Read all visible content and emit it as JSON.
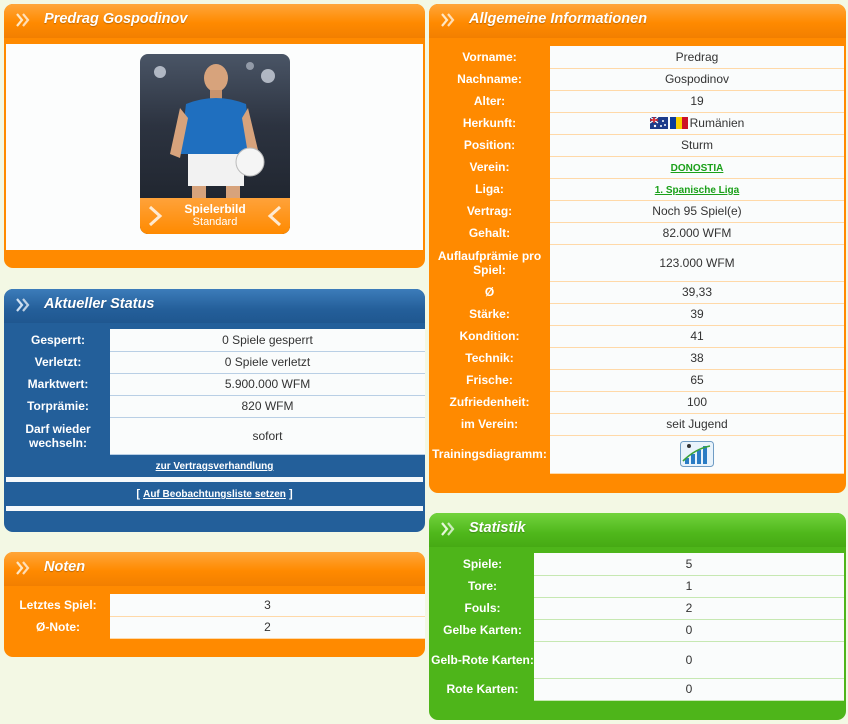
{
  "player_panel": {
    "title": "Predrag Gospodinov",
    "image_label_line1": "Spielerbild",
    "image_label_line2": "Standard"
  },
  "status": {
    "title": "Aktueller Status",
    "rows": [
      {
        "label": "Gesperrt:",
        "value": "0 Spiele gesperrt"
      },
      {
        "label": "Verletzt:",
        "value": "0 Spiele verletzt"
      },
      {
        "label": "Marktwert:",
        "value": "5.900.000 WFM"
      },
      {
        "label": "Torprämie:",
        "value": "820 WFM"
      },
      {
        "label": "Darf wieder wechseln:",
        "value": "sofort"
      }
    ],
    "contract_link": "zur Vertragsverhandlung",
    "watchlist_prefix": "[",
    "watchlist_link": "Auf Beobachtungsliste setzen",
    "watchlist_suffix": "]"
  },
  "noten": {
    "title": "Noten",
    "rows": [
      {
        "label": "Letztes Spiel:",
        "value": "3"
      },
      {
        "label": "Ø-Note:",
        "value": "2"
      }
    ]
  },
  "info": {
    "title": "Allgemeine Informationen",
    "rows": [
      {
        "label": "Vorname:",
        "value": "Predrag"
      },
      {
        "label": "Nachname:",
        "value": "Gospodinov"
      },
      {
        "label": "Alter:",
        "value": "19"
      },
      {
        "label": "Herkunft:",
        "value": "Rumänien"
      },
      {
        "label": "Position:",
        "value": "Sturm"
      },
      {
        "label": "Verein:",
        "value": "DONOSTIA"
      },
      {
        "label": "Liga:",
        "value": "1. Spanische Liga"
      },
      {
        "label": "Vertrag:",
        "value": "Noch 95 Spiel(e)"
      },
      {
        "label": "Gehalt:",
        "value": "82.000 WFM"
      },
      {
        "label": "Auflaufprämie pro Spiel:",
        "value": "123.000 WFM"
      },
      {
        "label": "Ø",
        "value": "39,33"
      },
      {
        "label": "Stärke:",
        "value": "39"
      },
      {
        "label": "Kondition:",
        "value": "41"
      },
      {
        "label": "Technik:",
        "value": "38"
      },
      {
        "label": "Frische:",
        "value": "65"
      },
      {
        "label": "Zufriedenheit:",
        "value": "100"
      },
      {
        "label": "im Verein:",
        "value": "seit Jugend"
      },
      {
        "label": "Trainingsdiagramm:",
        "value": ""
      }
    ]
  },
  "stats": {
    "title": "Statistik",
    "rows": [
      {
        "label": "Spiele:",
        "value": "5"
      },
      {
        "label": "Tore:",
        "value": "1"
      },
      {
        "label": "Fouls:",
        "value": "2"
      },
      {
        "label": "Gelbe Karten:",
        "value": "0"
      },
      {
        "label": "Gelb-Rote Karten:",
        "value": "0"
      },
      {
        "label": "Rote Karten:",
        "value": "0"
      }
    ]
  },
  "colors": {
    "orange": "#ff8a00",
    "blue": "#235f9a",
    "green": "#4eb51a",
    "link_green": "#1aa019"
  },
  "icons": {
    "header": "double-chevron-icon",
    "training": "bar-chart-icon"
  }
}
